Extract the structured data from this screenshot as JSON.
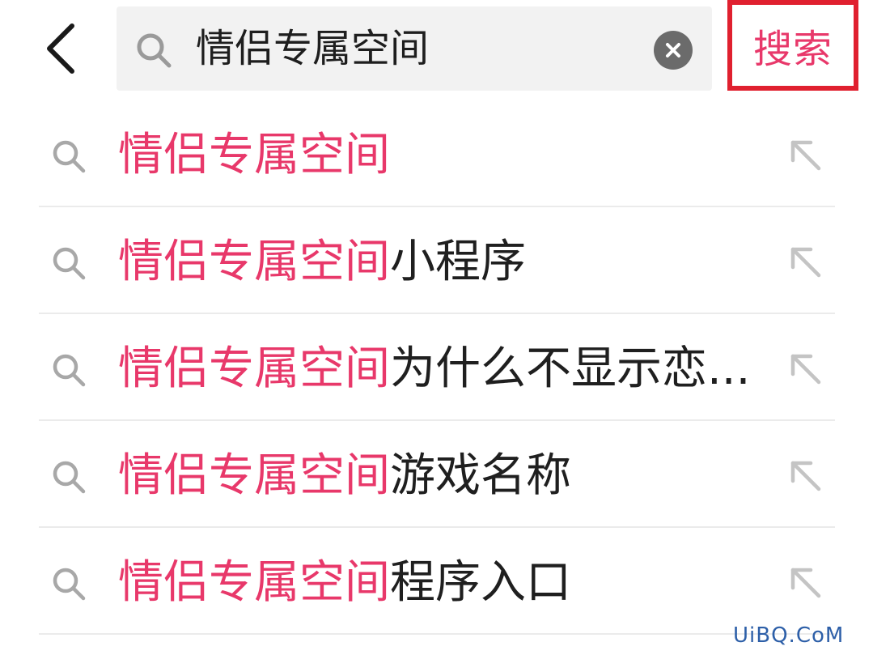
{
  "header": {
    "back_icon": "chevron-left-icon",
    "search": {
      "icon": "search-icon",
      "value": "情侣专属空间",
      "clear_icon": "close-icon"
    },
    "search_button_label": "搜索",
    "colors": {
      "accent": "#e8386a",
      "highlight_border": "#e0202f",
      "search_bg": "#f2f2f2"
    }
  },
  "suggestions": [
    {
      "highlight": "情侣专属空间",
      "rest": ""
    },
    {
      "highlight": "情侣专属空间",
      "rest": "小程序"
    },
    {
      "highlight": "情侣专属空间",
      "rest": "为什么不显示恋..."
    },
    {
      "highlight": "情侣专属空间",
      "rest": "游戏名称"
    },
    {
      "highlight": "情侣专属空间",
      "rest": "程序入口"
    }
  ],
  "suggestion_icons": {
    "leading": "search-icon",
    "trailing": "arrow-up-left-icon"
  },
  "watermark": "UiBQ.CoM"
}
